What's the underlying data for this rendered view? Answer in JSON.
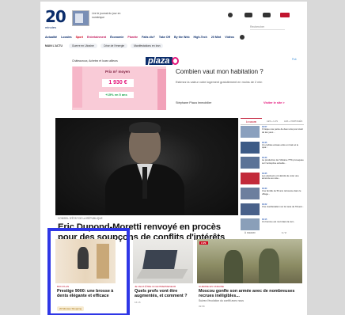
{
  "header": {
    "logo_number": "20",
    "logo_subtitle": "minutes",
    "promo_text": "Lire le journal du jour en numérique",
    "search_placeholder": "Rechercher"
  },
  "nav": {
    "items": [
      {
        "label": "Actualité",
        "color": "blue"
      },
      {
        "label": "Locales",
        "color": "blue"
      },
      {
        "label": "Sport",
        "color": "red"
      },
      {
        "label": "Entertainment",
        "color": "pink"
      },
      {
        "label": "Économie",
        "color": "blue"
      },
      {
        "label": "Planète",
        "color": "pink"
      },
      {
        "label": "Faits div?",
        "color": "blue"
      },
      {
        "label": "Take Off",
        "color": "blue"
      },
      {
        "label": "By the Web",
        "color": "blue"
      },
      {
        "label": "High-Tech",
        "color": "blue"
      },
      {
        "label": "20 Mint",
        "color": "blue"
      },
      {
        "label": "Vidéos",
        "color": "blue"
      }
    ]
  },
  "subnav": {
    "items": [
      "MAIN L'ACTU",
      "Guerre en Ukraine",
      "Crise de l'énergie",
      "Manifestations en Iran"
    ]
  },
  "ad": {
    "label": "Châteauroux, Achetez et louez ailleurs",
    "brand": "plaza",
    "prix_label": "Prix m² moyen",
    "price": "1 930 €",
    "trend": "+15% en 5 ans",
    "headline": "Combien vaut mon habitation ?",
    "description": "Estimez la valeur votre logement gratuitement en moins de 2 min",
    "advertiser": "Stéphane Plaza Immobilier",
    "cta": "Visiter le site >",
    "choice": "Pub"
  },
  "hero": {
    "kicker": "CONSEIL D'ÉTAT DE LA RÉPUBLIQUE",
    "title": "Eric Dupond-Moretti renvoyé en procès pour des soupçons de conflits d'intérêts"
  },
  "side": {
    "tabs": [
      "À CHAUD",
      "LES + LUS",
      "LES + PARTAGÉS"
    ],
    "items": [
      {
        "time": "09:57",
        "text": "Il risque une peine de deux ans pour avoir de tes yeux...",
        "color": "#8aa0be"
      },
      {
        "time": "09:45",
        "text": "Un cycliste écrasé entre un train et le quai...",
        "color": "#3d5b86"
      },
      {
        "time": "09:40",
        "text": "La production de l'Ukraine ??% provoquée sur l'entreprise actuelle...",
        "color": "#5b7397"
      },
      {
        "time": "09:35",
        "text": "Les électeurs ont décidé de voter une annonce au vote...",
        "color": "#c22a3a"
      },
      {
        "time": "09:30",
        "text": "Une famille de 50 ans retrouvée dans le village...",
        "color": "#6c7f9e"
      },
      {
        "time": "09:22",
        "text": "Une manifestation sur la route de l'Ouest...",
        "color": "#49618a"
      },
      {
        "time": "09:15",
        "text": "Un homme est mort dans la nuit...",
        "color": "#8a9fb9"
      }
    ],
    "footer": "À CHAUD",
    "pager": "1 / 2"
  },
  "cards": [
    {
      "kicker": "BON PLAN",
      "title": "Prestige 9000: une brosse à dents élégante et efficace",
      "tag": "20 Minutes Shopping"
    },
    {
      "kicker": "JE VEUX ÊTRE UN ENTREPRENEUR",
      "title": "Quels profs vont être augmentés, et comment ?",
      "meta": "16:15"
    },
    {
      "live": "LIVE",
      "kicker": "GUERRE EN UKRAINE",
      "title": "Moscou gonfle son armée avec de nombreuses recrues inéligibles...",
      "desc": "Suivez l'évolution du conflit avec nous",
      "meta": "09:58"
    }
  ]
}
